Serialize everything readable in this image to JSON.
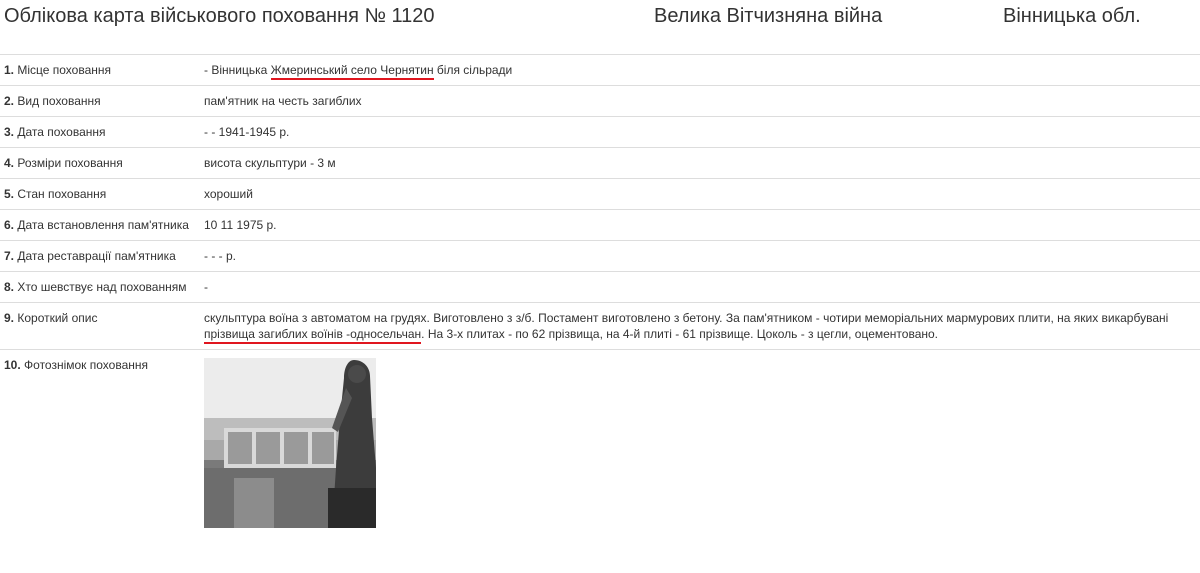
{
  "header": {
    "title": "Облікова карта військового поховання № 1120",
    "war": "Велика Вітчизняна війна",
    "region": "Вінницька обл."
  },
  "rows": [
    {
      "num": "1.",
      "label": "Місце поховання",
      "value_pre": "- Вінницька ",
      "value_underlined": "Жмеринський село Чернятин",
      "value_post": " біля сільради"
    },
    {
      "num": "2.",
      "label": "Вид поховання",
      "value": "пам'ятник на честь загиблих"
    },
    {
      "num": "3.",
      "label": "Дата поховання",
      "value": "- - 1941-1945 р."
    },
    {
      "num": "4.",
      "label": "Розміри поховання",
      "value": "висота скульптури - 3 м"
    },
    {
      "num": "5.",
      "label": "Стан поховання",
      "value": "хороший"
    },
    {
      "num": "6.",
      "label": "Дата встановлення пам'ятника",
      "value": "10 11 1975 р."
    },
    {
      "num": "7.",
      "label": "Дата реставрації пам'ятника",
      "value": "- - - р."
    },
    {
      "num": "8.",
      "label": "Хто шевствує над похованням",
      "value": "-"
    },
    {
      "num": "9.",
      "label": "Короткий опис",
      "value_pre": "скульптура воїна з автоматом на грудях. Виготовлено з з/б. Постамент виготовлено з бетону. За пам'ятником - чотири меморіальних мармурових плити, на яких викарбувані ",
      "value_underlined": "прізвища загиблих воїнів -односельчан",
      "value_post": ". На 3-х плитах - по 62 прізвища, на 4-й плиті - 61 прізвище. Цоколь - з цегли, оцементовано."
    },
    {
      "num": "10.",
      "label": "Фотознімок поховання"
    }
  ],
  "colors": {
    "underline": "#e0161f"
  }
}
